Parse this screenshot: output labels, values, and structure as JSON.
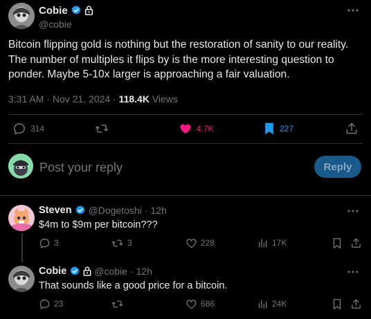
{
  "tweet": {
    "author": {
      "display_name": "Cobie",
      "handle": "@cobie",
      "verified": true,
      "protected": true
    },
    "text": "Bitcoin flipping gold is nothing but the restoration of sanity to our reality.\nThe number of multiples it flips by is the more interesting question to\nponder. Maybe 5-10x larger is approaching a fair valuation.",
    "time": "3:31 AM",
    "dot": "·",
    "date": "Nov 21, 2024",
    "views_count": "118.4K",
    "views_label": "Views",
    "stats": {
      "replies": "314",
      "reposts": "",
      "likes": "4.7K",
      "bookmarks": "227"
    }
  },
  "reply_composer": {
    "placeholder": "Post your reply",
    "button_label": "Reply"
  },
  "replies": [
    {
      "display_name": "Steven",
      "handle": "@Dogetoshi",
      "sep": "·",
      "time": "12h",
      "text": "$4m to $9m per bitcoin???",
      "replies": "3",
      "reposts": "3",
      "likes": "228",
      "views": "17K"
    },
    {
      "display_name": "Cobie",
      "handle": "@cobie",
      "sep": "·",
      "time": "12h",
      "text": "That sounds like a good price for a bitcoin.",
      "replies": "23",
      "reposts": "",
      "likes": "686",
      "views": "24K"
    }
  ],
  "colors": {
    "background": "#000000",
    "text": "#e7e9ea",
    "muted": "#71767b",
    "accent": "#1d9bf0",
    "like": "#f91880",
    "divider": "#2f3336"
  }
}
